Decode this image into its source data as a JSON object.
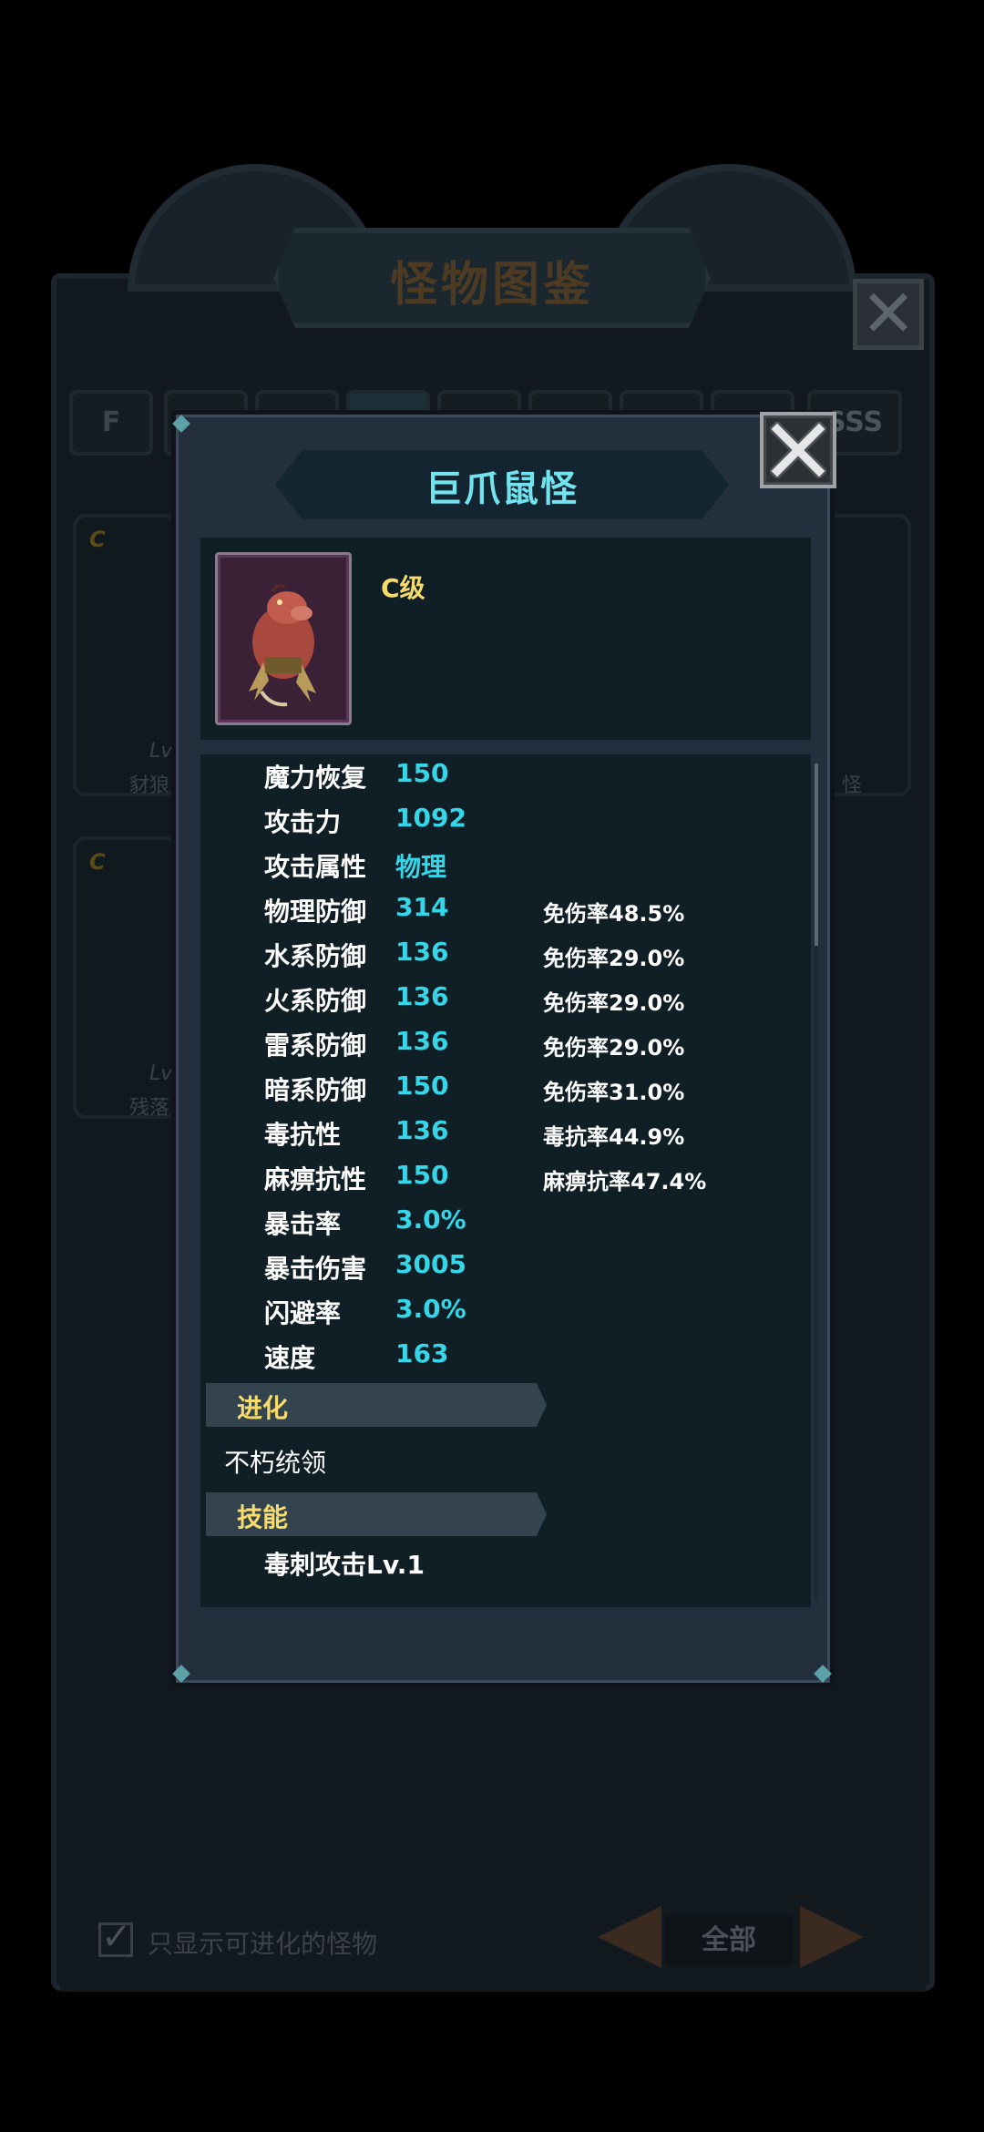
{
  "background": {
    "title": "怪物图鉴",
    "close_glyph": "✕",
    "tabs": [
      "F",
      "SSS"
    ],
    "cards": [
      {
        "grade": "C",
        "level": "Lv",
        "name": "豺狼"
      },
      {
        "grade": "C",
        "level": "Lv",
        "name": "残落"
      },
      {
        "grade": "",
        "level": "",
        "name": "怪"
      }
    ],
    "filter_checkbox_label": "只显示可进化的怪物",
    "filter_value": "全部"
  },
  "modal": {
    "monster_name": "巨爪鼠怪",
    "grade": "C级",
    "close_glyph": "✕",
    "stats": [
      {
        "label": "魔力恢复",
        "value": "150",
        "extra": ""
      },
      {
        "label": "攻击力",
        "value": "1092",
        "extra": ""
      },
      {
        "label": "攻击属性",
        "value": "物理",
        "extra": ""
      },
      {
        "label": "物理防御",
        "value": "314",
        "extra": "免伤率48.5%"
      },
      {
        "label": "水系防御",
        "value": "136",
        "extra": "免伤率29.0%"
      },
      {
        "label": "火系防御",
        "value": "136",
        "extra": "免伤率29.0%"
      },
      {
        "label": "雷系防御",
        "value": "136",
        "extra": "免伤率29.0%"
      },
      {
        "label": "暗系防御",
        "value": "150",
        "extra": "免伤率31.0%"
      },
      {
        "label": "毒抗性",
        "value": "136",
        "extra": "毒抗率44.9%"
      },
      {
        "label": "麻痹抗性",
        "value": "150",
        "extra": "麻痹抗率47.4%"
      },
      {
        "label": "暴击率",
        "value": "3.0%",
        "extra": ""
      },
      {
        "label": "暴击伤害",
        "value": "3005",
        "extra": ""
      },
      {
        "label": "闪避率",
        "value": "3.0%",
        "extra": ""
      },
      {
        "label": "速度",
        "value": "163",
        "extra": ""
      }
    ],
    "evolution_title": "进化",
    "evolution_target": "不朽统领",
    "skills_title": "技能",
    "skill_name": "毒刺攻击Lv.1"
  },
  "colors": {
    "name_accent": "#73e3f0",
    "value_accent": "#35d6e8",
    "gold_accent": "#f7dc6b"
  }
}
